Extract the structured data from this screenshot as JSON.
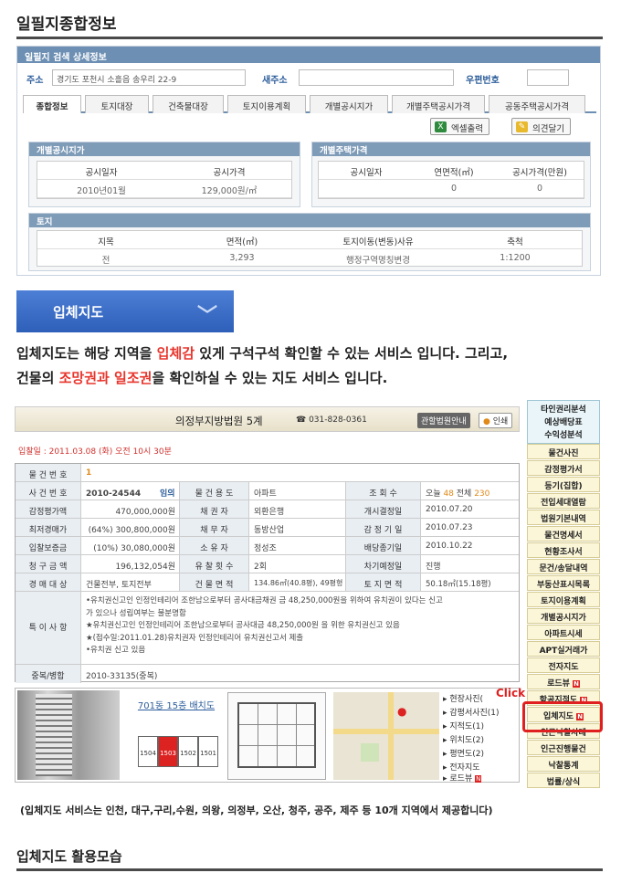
{
  "page_title": "일필지종합정보",
  "panel": {
    "title": "일필지 검색 상세정보",
    "addr_label": "주소",
    "addr_value": "경기도 포천시 소흘읍 송우리 22-9",
    "new_addr_label": "새주소",
    "new_addr_value": "",
    "zip_label": "우편번호",
    "zip_value": "",
    "tabs": [
      "종합정보",
      "토지대장",
      "건축물대장",
      "토지이용계획",
      "개별공시지가",
      "개별주택공시가격",
      "공동주택공시가격"
    ],
    "excel_button": "엑셀출력",
    "opinion_button": "의견달기",
    "land_price": {
      "title": "개별공시지가",
      "headers": [
        "공시일자",
        "공시가격"
      ],
      "row": [
        "2010년01월",
        "129,000원/㎡"
      ]
    },
    "house_price": {
      "title": "개별주택가격",
      "headers": [
        "공시일자",
        "연면적(㎡)",
        "공시가격(만원)"
      ],
      "row": [
        "",
        "0",
        "0"
      ]
    },
    "land": {
      "title": "토지",
      "headers": [
        "지목",
        "면적(㎡)",
        "토지이동(변동)사유",
        "축척"
      ],
      "row": [
        "전",
        "3,293",
        "행정구역명칭변경",
        "1:1200"
      ]
    }
  },
  "band_label": "입체지도",
  "description": {
    "p1_pre": "입체지도는 해당 지역을 ",
    "p1_red": "입체감",
    "p1_post": " 있게 구석구석 확인할 수 있는 서비스 입니다. 그리고,",
    "p2_pre": "건물의 ",
    "p2_red": "조망권과 일조권",
    "p2_post": "을 확인하실 수 있는 지도 서비스 입니다."
  },
  "auction": {
    "court": "의정부지방법원 5계",
    "phone": "031-828-0361",
    "court_info_btn": "관할법원안내",
    "print_btn": "인쇄",
    "bid_date": "입찰일 : 2011.03.08 (화) 오전 10시 30분",
    "rows": [
      {
        "l1": "물 건 번 호",
        "v1": "1"
      },
      {
        "l1": "사 건 번 호",
        "v1": "2010-24544",
        "v1b": "임의",
        "l2": "물 건 용 도",
        "v2": "아파트",
        "l3": "조 회 수",
        "v3a": "오늘",
        "v3b": "48",
        "v3c": "전체",
        "v3d": "230"
      },
      {
        "l1": "감정평가액",
        "v1": "470,000,000원",
        "l2": "채 권 자",
        "v2": "외환은행",
        "l3": "개시결정일",
        "v3": "2010.07.20"
      },
      {
        "l1": "최저경매가",
        "v1": "(64%) 300,800,000원",
        "l2": "채 무 자",
        "v2": "동방산업",
        "l3": "감 정 기 일",
        "v3": "2010.07.23"
      },
      {
        "l1": "입찰보증금",
        "v1": "(10%) 30,080,000원",
        "l2": "소 유 자",
        "v2": "정성조",
        "l3": "배당종기일",
        "v3": "2010.10.22"
      },
      {
        "l1": "청 구 금 액",
        "v1": "196,132,054원",
        "l2": "유 찰 횟 수",
        "v2": "2회",
        "l3": "차기예정일",
        "v3": "진행"
      },
      {
        "l1": "경 매 대 상",
        "v1": "건물전부, 토지전부",
        "l2": "건 물 면 적",
        "v2": "134.86㎡(40.8평), 49평형",
        "l3": "토 지 면 적",
        "v3": "50.18㎡(15.18평)"
      }
    ],
    "special_label": "특 이 사 항",
    "special_lines": [
      "•유치권신고인 인정인테리어 조한남으로부터 공사대금채권 금 48,250,000원을 위하여 유치권이 있다는 신고",
      "가 있으나 성립여부는 불분명함",
      "★유치권신고인 인정인테리어 조한남으로부터 공사대금 48,250,000원 을 위한 유치권신고 있음",
      "★(접수일:2011.01.28)유치권자 인정인테리어 유치권신고서 제출",
      "•유치권 신고 있음"
    ],
    "dup_label": "중복/병합",
    "dup_value": "2010-33135(중복)",
    "layout_title": "701동 15층 배치도",
    "units": [
      "1504",
      "1503",
      "1502",
      "1501"
    ],
    "links": [
      "현장사진(",
      "감평서사진(1)",
      "지적도(1)",
      "위치도(2)",
      "평면도(2)",
      "전자지도",
      "로드뷰"
    ]
  },
  "sidebar": [
    "타인권리분석",
    "예상배당표",
    "수익성분석",
    "물건사진",
    "감정평가서",
    "등기(집합)",
    "전입세대열람",
    "법원기본내역",
    "물건명세서",
    "현황조사서",
    "문건/송달내역",
    "부동산표시목록",
    "토지이용계획",
    "개별공시지가",
    "아파트시세",
    "APT실거래가",
    "전자지도",
    "로드뷰",
    "항공지적도",
    "입체지도",
    "인근낙찰사례",
    "인근진행물건",
    "낙찰통계",
    "법률/상식"
  ],
  "click_label": "Click",
  "footnote": "(입체지도 서비스는 인천, 대구,구리,수원, 의왕, 의정부, 오산, 청주, 공주, 제주 등 10개 지역에서 제공합니다)",
  "section2_title": "입체지도 활용모습"
}
